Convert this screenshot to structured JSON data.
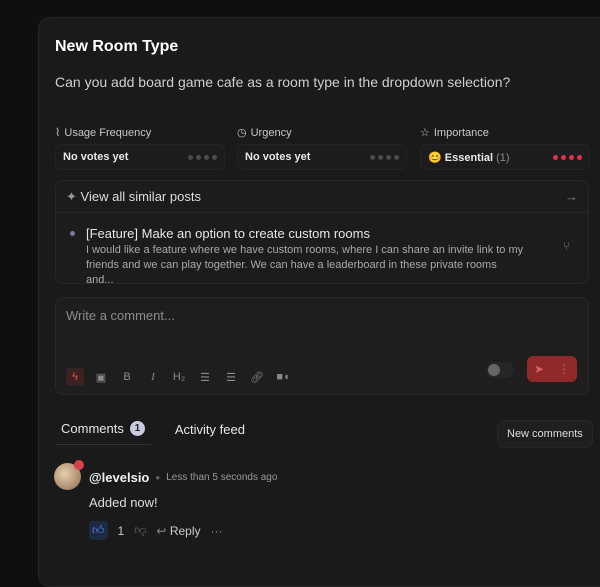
{
  "post": {
    "title": "New Room Type",
    "description": "Can you add board game cafe as a room type in the dropdown selection?"
  },
  "metrics": [
    {
      "label": "Usage Frequency",
      "icon": "pulse-icon",
      "value": "No votes yet",
      "level": 0
    },
    {
      "label": "Urgency",
      "icon": "clock-icon",
      "value": "No votes yet",
      "level": 0
    },
    {
      "label": "Importance",
      "icon": "star-icon",
      "value": "Essential",
      "count": "(1)",
      "level": 4
    }
  ],
  "similar": {
    "header": "View all similar posts",
    "posts": [
      {
        "title": "[Feature] Make an option to create custom rooms",
        "body": "I would like a feature where we have custom rooms, where I can share an invite link to my friends and we can play together. We can have a leaderboard in these private rooms and..."
      }
    ]
  },
  "composer": {
    "placeholder": "Write a comment...",
    "toolbar": [
      "B",
      "I",
      "H₂"
    ]
  },
  "tabs": [
    {
      "label": "Comments",
      "count": "1"
    },
    {
      "label": "Activity feed"
    }
  ],
  "new_comments_label": "New comments",
  "comments": [
    {
      "author": "@levelsio",
      "time": "Less than 5 seconds ago",
      "text": "Added now!",
      "likes": "1",
      "reply_label": "Reply"
    }
  ],
  "colors": {
    "accent": "#e0314a",
    "send": "#8f2a2a"
  }
}
